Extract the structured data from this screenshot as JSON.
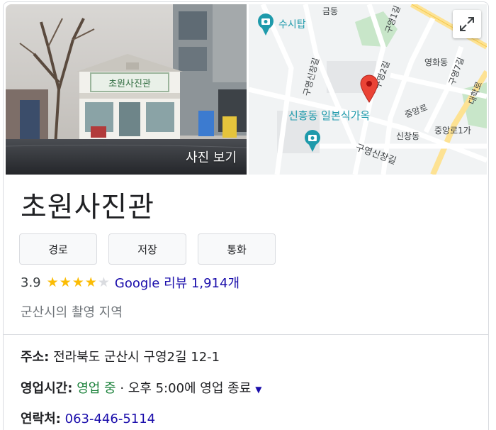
{
  "photo": {
    "view_label": "사진 보기",
    "sign_text": "초원사진관"
  },
  "map": {
    "labels": {
      "geumdong": "금동",
      "susitap": "수시탑",
      "guyeong1gil": "구영1길",
      "yeonghwadong": "영화동",
      "guyeong7gil": "구영7길",
      "daehakro": "대학로",
      "guyeongsinchanggil_top": "구영신창길",
      "guyeong2gil": "구영2길",
      "jungangro": "중앙로",
      "sinheungdong": "신흥동 일본식가옥",
      "sinchangdong": "신창동",
      "jungangro1ga": "중앙로1가",
      "guyeongsinchanggil_bottom": "구영신창길"
    }
  },
  "place": {
    "name": "초원사진관",
    "actions": {
      "directions": "경로",
      "save": "저장",
      "call": "통화"
    },
    "rating": {
      "value": "3.9",
      "stars": 4,
      "review_text": "Google 리뷰 1,914개"
    },
    "category": "군산시의 촬영 지역",
    "address": {
      "label": "주소:",
      "value": "전라북도 군산시 구영2길 12-1"
    },
    "hours": {
      "label": "영업시간:",
      "status": "영업 중",
      "separator": " · ",
      "detail": "오후 5:00에 영업 종료"
    },
    "phone": {
      "label": "연락처:",
      "value": "063-446-5114"
    }
  },
  "colors": {
    "accent_link": "#1a0dab",
    "open_green": "#188038",
    "star": "#fbbc04",
    "map_pin": "#ea4335",
    "poi_teal": "#1e9aab"
  }
}
